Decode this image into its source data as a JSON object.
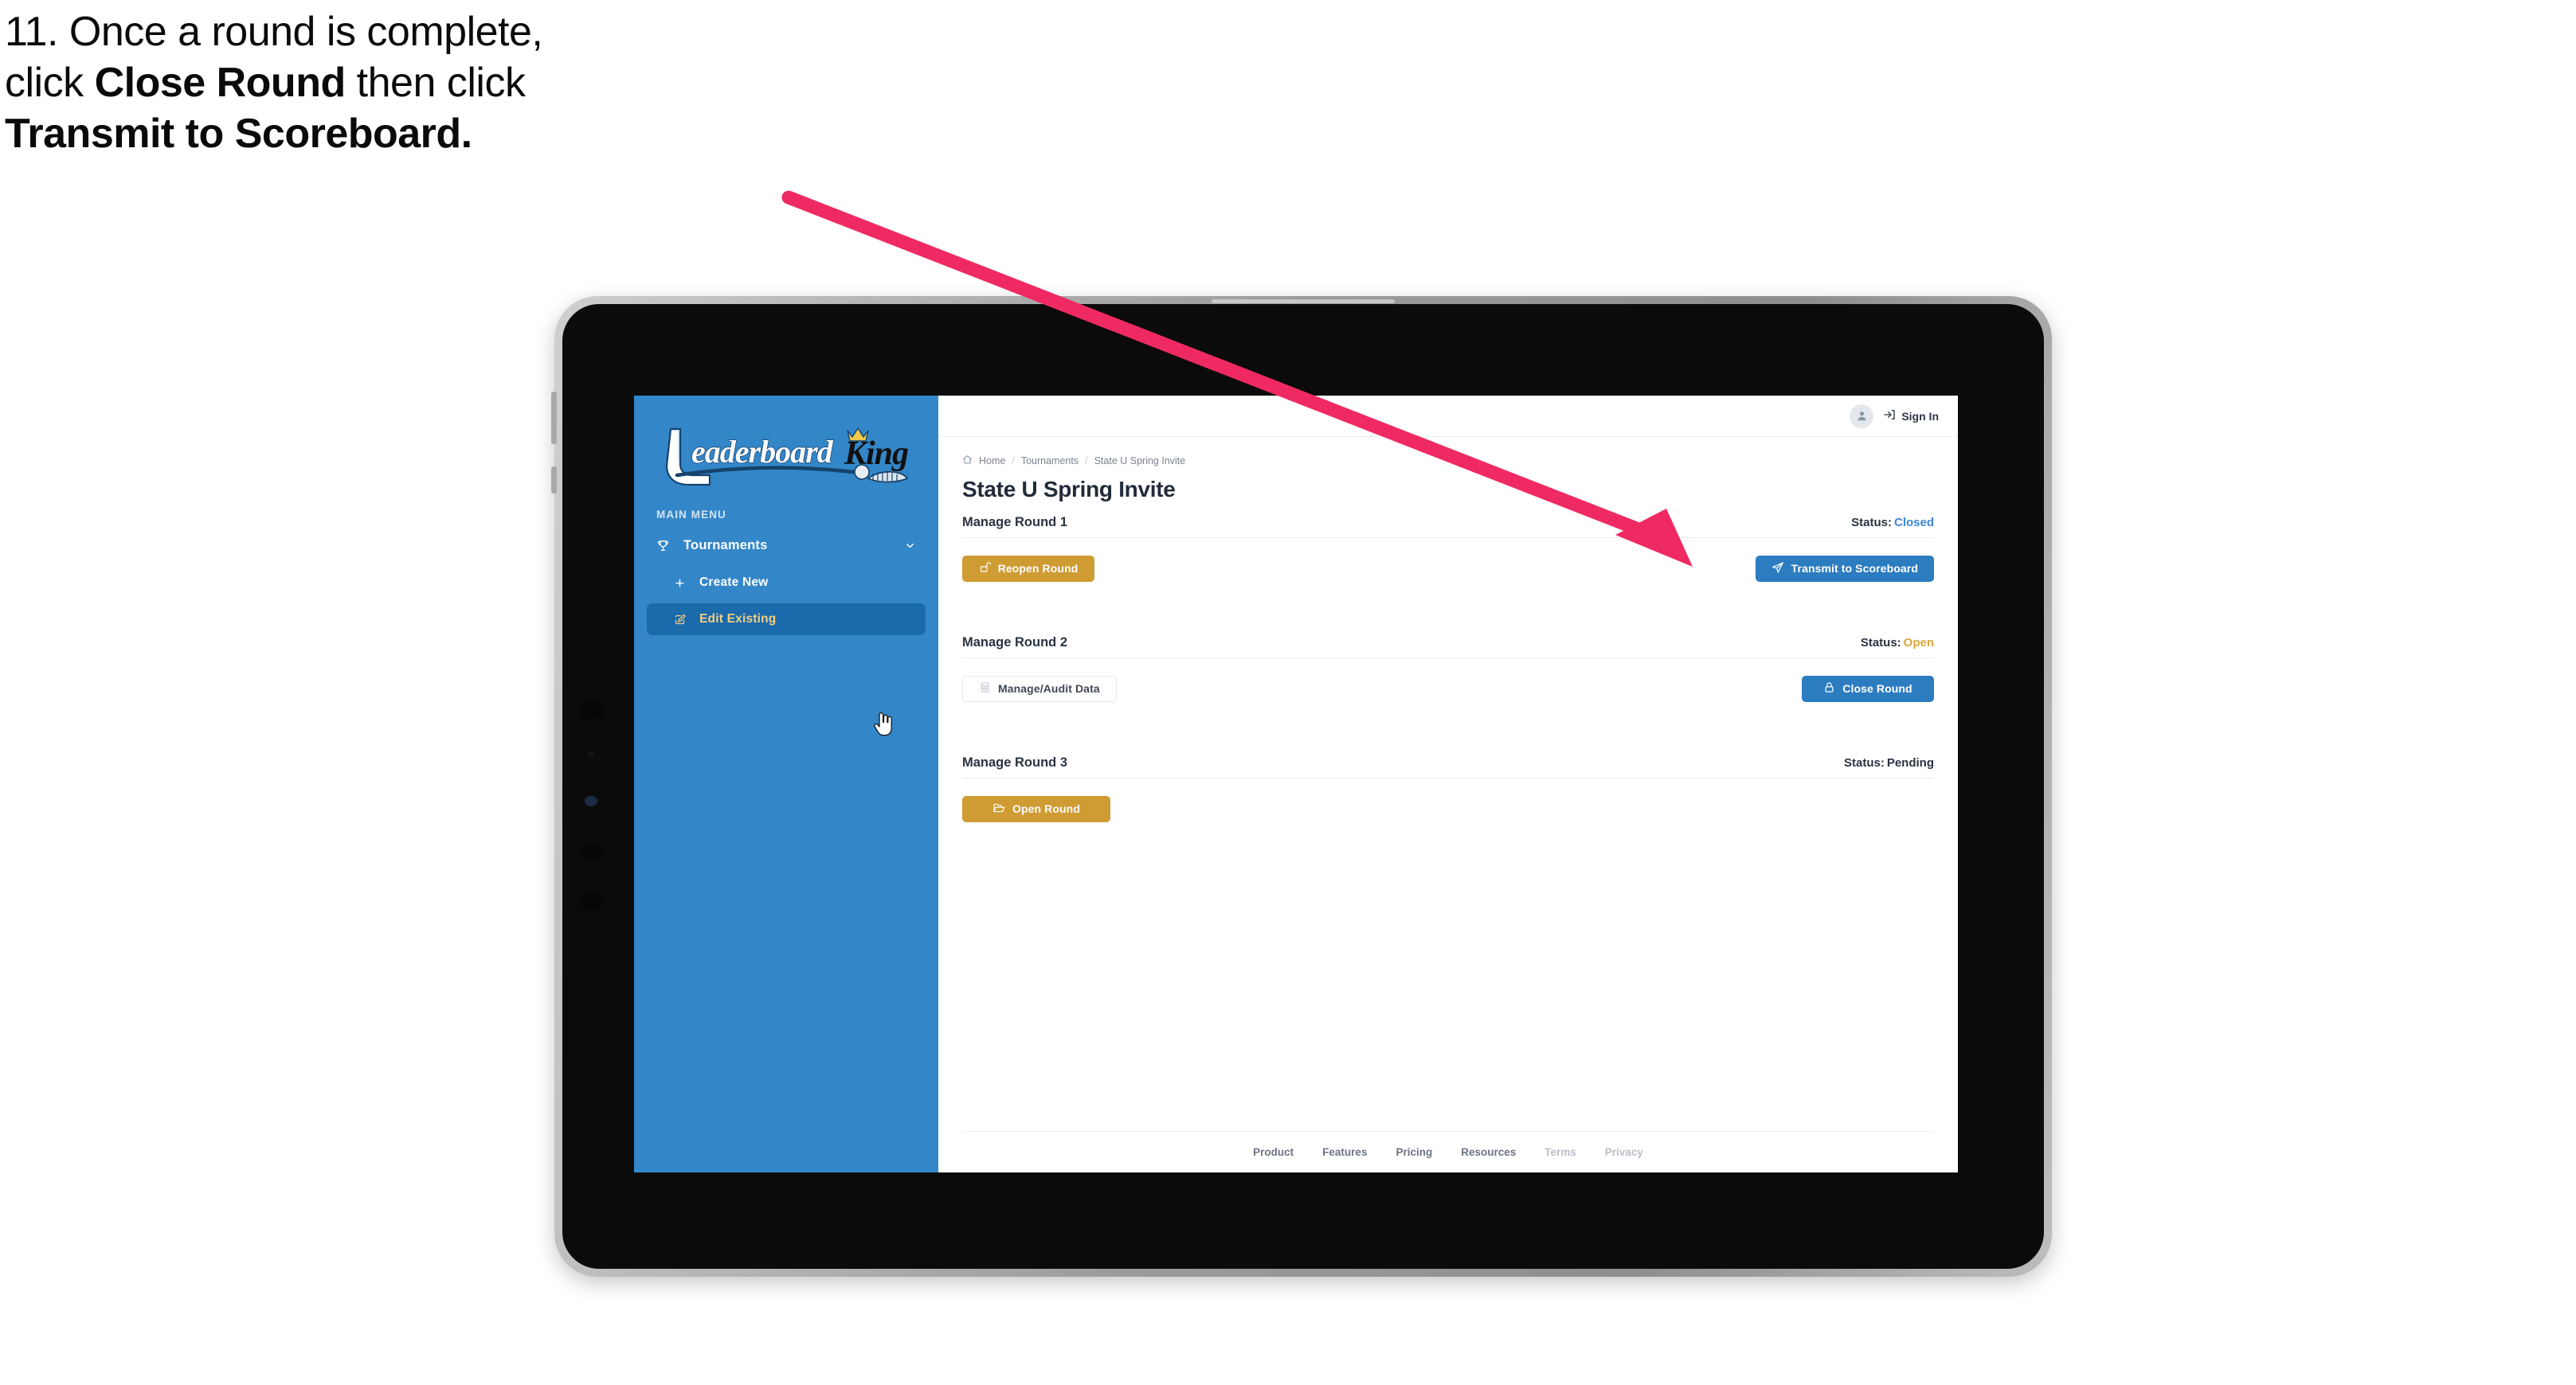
{
  "caption": {
    "line1_a": "11. Once a round is complete,",
    "line2_a": "click ",
    "line2_b": "Close Round",
    "line2_c": " then click",
    "line3_b": "Transmit to Scoreboard."
  },
  "colors": {
    "sidebar_blue": "#3386C8",
    "sidebar_active_blue": "#1B6AAB",
    "sidebar_active_text": "#F1CE84",
    "gold": "#CF9B33",
    "blue": "#2C7CC0",
    "status_closed": "#3B86D2",
    "status_open": "#D9A63C",
    "arrow_pink": "#EF2A63",
    "title_navy": "#222B3A"
  },
  "sidebar": {
    "logo_primary": "Leaderboard",
    "logo_secondary": "King",
    "logo_icon": "golf-club-icon",
    "menu_label": "MAIN MENU",
    "items": [
      {
        "label": "Tournaments",
        "icon": "trophy-icon",
        "chevron": "chevron-down-icon",
        "active": false
      },
      {
        "label": "Create New",
        "icon": "plus-icon",
        "active": false
      },
      {
        "label": "Edit Existing",
        "icon": "pencil-square-icon",
        "active": true
      }
    ]
  },
  "topbar": {
    "avatar_icon": "user-avatar-icon",
    "signin_icon": "sign-in-arrow-icon",
    "signin_label": "Sign In"
  },
  "breadcrumb": {
    "home_icon": "home-icon",
    "items": [
      "Home",
      "Tournaments",
      "State U Spring Invite"
    ],
    "separator": "/"
  },
  "page": {
    "title": "State U Spring Invite"
  },
  "rounds": [
    {
      "title": "Manage Round 1",
      "status_label": "Status:",
      "status_value": "Closed",
      "status_kind": "closed",
      "left_button": {
        "label": "Reopen Round",
        "icon": "unlock-icon",
        "style": "gold"
      },
      "right_button": {
        "label": "Transmit to Scoreboard",
        "icon": "paper-plane-icon",
        "style": "blue"
      }
    },
    {
      "title": "Manage Round 2",
      "status_label": "Status:",
      "status_value": "Open",
      "status_kind": "open",
      "left_button": {
        "label": "Manage/Audit Data",
        "icon": "table-grid-icon",
        "style": "ghost"
      },
      "right_button": {
        "label": "Close Round",
        "icon": "lock-icon",
        "style": "blue"
      }
    },
    {
      "title": "Manage Round 3",
      "status_label": "Status:",
      "status_value": "Pending",
      "status_kind": "pending",
      "left_button": {
        "label": "Open Round",
        "icon": "folder-open-icon",
        "style": "gold"
      },
      "right_button": null
    }
  ],
  "footer": {
    "links": [
      {
        "label": "Product",
        "dim": false
      },
      {
        "label": "Features",
        "dim": false
      },
      {
        "label": "Pricing",
        "dim": false
      },
      {
        "label": "Resources",
        "dim": false
      },
      {
        "label": "Terms",
        "dim": true
      },
      {
        "label": "Privacy",
        "dim": true
      }
    ]
  },
  "annotation": {
    "arrow_icon": "pointer-arrow-icon"
  },
  "cursor": {
    "icon": "hand-pointer-cursor"
  }
}
